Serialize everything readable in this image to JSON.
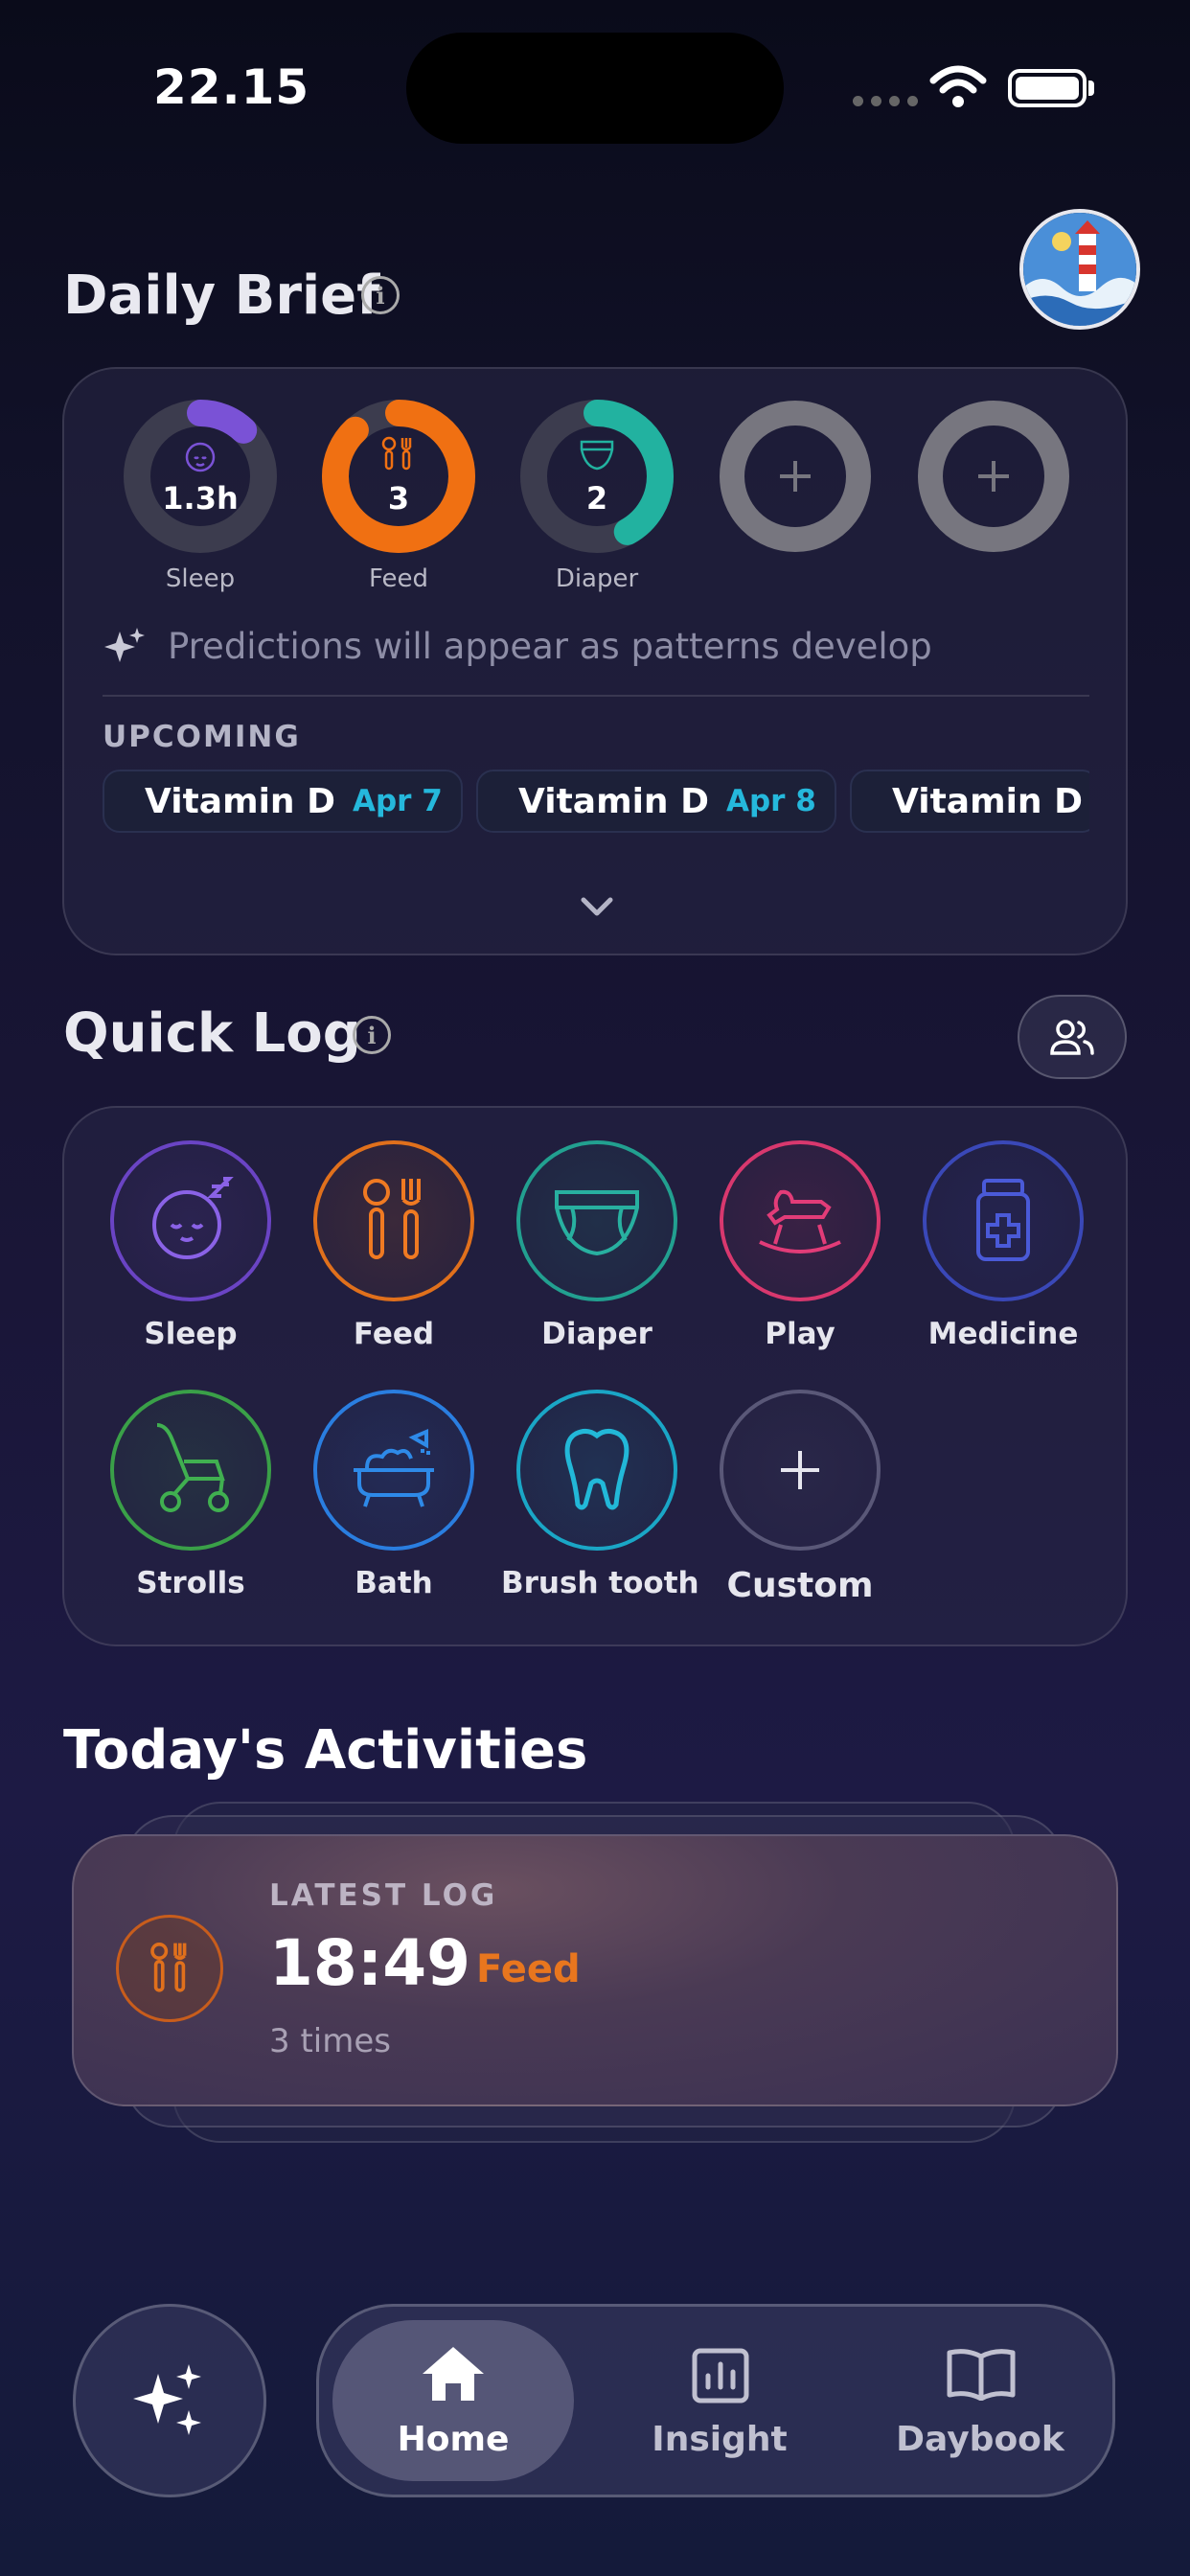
{
  "status": {
    "time": "22.15"
  },
  "daily_brief": {
    "title": "Daily Brief",
    "rings": [
      {
        "label": "Sleep",
        "value": "1.3h",
        "progress": 0.12,
        "color": "#7a52d6"
      },
      {
        "label": "Feed",
        "value": "3",
        "progress": 0.88,
        "color": "#f07012"
      },
      {
        "label": "Diaper",
        "value": "2",
        "progress": 0.42,
        "color": "#22b2a0"
      }
    ],
    "prediction_text": "Predictions will appear as patterns develop",
    "upcoming_label": "UPCOMING",
    "upcoming": [
      {
        "name": "Vitamin D",
        "date": "Apr 7"
      },
      {
        "name": "Vitamin D",
        "date": "Apr 8"
      },
      {
        "name": "Vitamin D",
        "date": ""
      }
    ]
  },
  "quick_log": {
    "title": "Quick Log",
    "items": [
      {
        "label": "Sleep",
        "icon": "sleep-icon",
        "color": "#6a44c4"
      },
      {
        "label": "Feed",
        "icon": "feed-icon",
        "color": "#e0701c"
      },
      {
        "label": "Diaper",
        "icon": "diaper-icon",
        "color": "#22a090"
      },
      {
        "label": "Play",
        "icon": "rocking-horse-icon",
        "color": "#d8386e"
      },
      {
        "label": "Medicine",
        "icon": "medicine-icon",
        "color": "#3a48b8"
      },
      {
        "label": "Strolls",
        "icon": "stroller-icon",
        "color": "#3aa048"
      },
      {
        "label": "Bath",
        "icon": "bath-icon",
        "color": "#2a7ee0"
      },
      {
        "label": "Brush tooth",
        "icon": "tooth-icon",
        "color": "#1aa6c6"
      },
      {
        "label": "Custom",
        "icon": "plus-icon",
        "color": "#5a5878"
      }
    ]
  },
  "activities": {
    "title": "Today's Activities",
    "latest_label": "LATEST LOG",
    "time": "18:49",
    "type": "Feed",
    "count": "3 times"
  },
  "nav": {
    "home": "Home",
    "insight": "Insight",
    "daybook": "Daybook"
  }
}
